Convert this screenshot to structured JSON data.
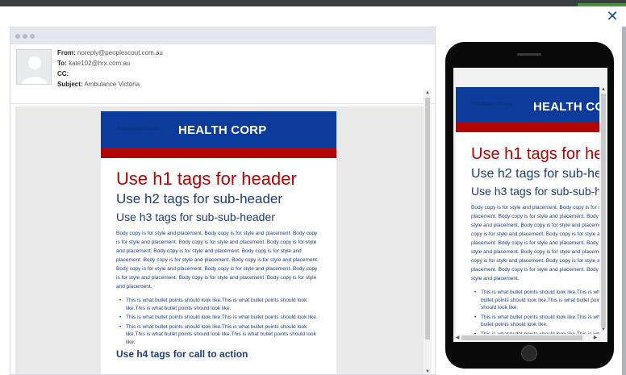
{
  "dialog": {
    "close_icon": "close-icon"
  },
  "email_header": {
    "from_label": "From:",
    "from_value": "noreply@peoplescout.com.au",
    "to_label": "To:",
    "to_value": "kate102@hrx.com.au",
    "cc_label": "CC:",
    "cc_value": "",
    "subject_label": "Subject:",
    "subject_value": "Ambulance Victoria"
  },
  "template": {
    "logo_text": "Ambulance Victoria",
    "brand": "HEALTH CORP",
    "h1": "Use h1 tags for header",
    "h2": "Use h2 tags for sub-header",
    "h3": "Use h3 tags for sub-sub-header",
    "body": "Body copy is for style and placement. Body copy is for style and placement. Body copy is for style and placement. Body copy is for style and placement. Body copy is for style and placement. Body copy is for style and placement. Body copy is for style and placement. Body copy is for style and placement. Body copy is for style and placement. Body copy is for style and placement. Body copy is for style and placement. Body copy is for style and placement. Body copy is for style and placement. Body copy is for style and placement.",
    "bullets": [
      "This is what bullet points should look like.This is what bullet points should look like.This is what bullet points should look like.",
      "This is what bullet points should look like.This is what bullet points should look like.",
      "This is what bullet points should look like.This is what bullet points should look like.This is what bullet points should look like.This is what bullet points should look like."
    ],
    "h4": "Use h4 tags for call to action"
  },
  "colors": {
    "brand_blue": "#0b3c9c",
    "brand_red": "#b30404",
    "heading_blue": "#1b3d7a"
  }
}
